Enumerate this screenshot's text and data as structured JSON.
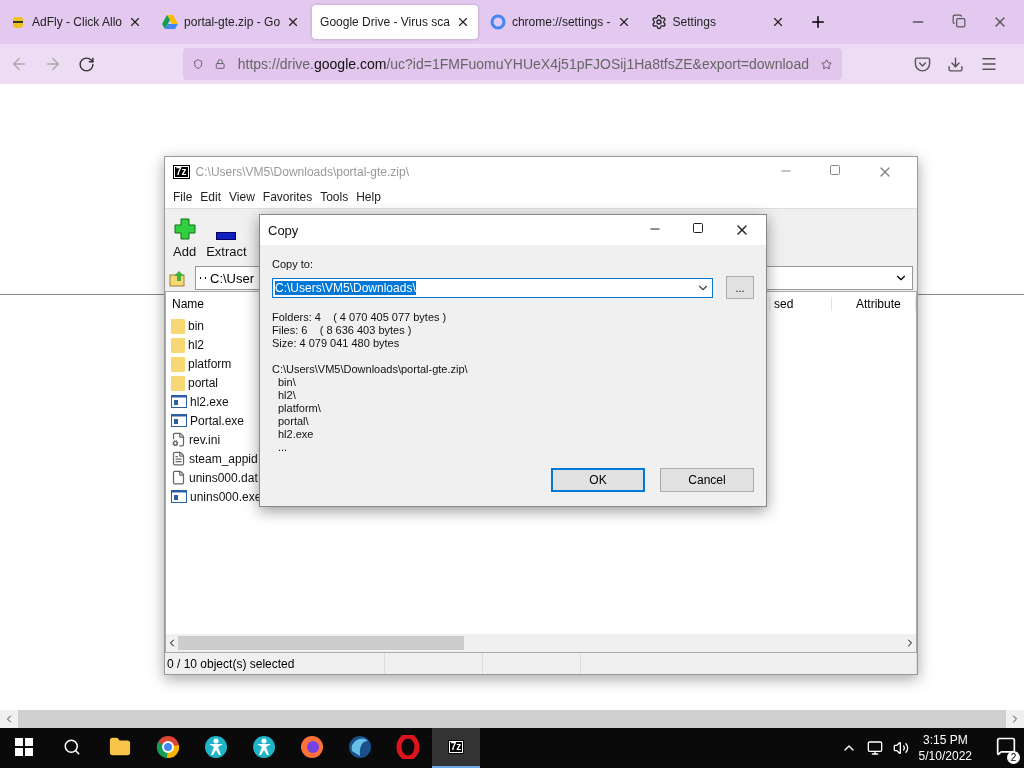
{
  "browser": {
    "tabs": [
      {
        "label": "AdFly - Click Allo",
        "selected": false,
        "kind": "bee"
      },
      {
        "label": "portal-gte.zip - Go",
        "selected": false,
        "kind": "drive"
      },
      {
        "label": "Google Drive - Virus sca",
        "selected": true,
        "kind": "none"
      },
      {
        "label": "chrome://settings -",
        "selected": false,
        "kind": "google"
      },
      {
        "label": "Settings",
        "selected": false,
        "kind": "gear"
      }
    ],
    "url": {
      "prefix": "https://drive.",
      "domain": "google.com",
      "rest": "/uc?id=1FMFuomuYHUeX4j51pFJOSij1Ha8tfsZE&export=download"
    }
  },
  "archiver": {
    "title": "C:\\Users\\VM5\\Downloads\\portal-gte.zip\\",
    "logo": "7z",
    "menu": [
      "File",
      "Edit",
      "View",
      "Favorites",
      "Tools",
      "Help"
    ],
    "toolbar": [
      {
        "label": "Add",
        "kind": "add"
      },
      {
        "label": "Extract",
        "kind": "extract"
      }
    ],
    "address": "C:\\User",
    "columns": [
      "Name",
      "sed",
      "Attribute"
    ],
    "files": [
      {
        "name": "bin",
        "kind": "folder"
      },
      {
        "name": "hl2",
        "kind": "folder"
      },
      {
        "name": "platform",
        "kind": "folder"
      },
      {
        "name": "portal",
        "kind": "folder"
      },
      {
        "name": "hl2.exe",
        "kind": "exe"
      },
      {
        "name": "Portal.exe",
        "kind": "exe"
      },
      {
        "name": "rev.ini",
        "kind": "config"
      },
      {
        "name": "steam_appid",
        "kind": "text"
      },
      {
        "name": "unins000.dat",
        "kind": "file"
      },
      {
        "name": "unins000.exe",
        "kind": "exe"
      }
    ],
    "status": "0 / 10 object(s) selected"
  },
  "dialog": {
    "title": "Copy",
    "label": "Copy to:",
    "value": "C:\\Users\\VM5\\Downloads\\",
    "browse": "...",
    "info": [
      "Folders: 4    ( 4 070 405 077 bytes )",
      "Files: 6    ( 8 636 403 bytes )",
      "Size: 4 079 041 480 bytes"
    ],
    "listing": {
      "path": "C:\\Users\\VM5\\Downloads\\portal-gte.zip\\",
      "items": [
        "bin\\",
        "hl2\\",
        "platform\\",
        "portal\\",
        "hl2.exe",
        "..."
      ]
    },
    "buttons": [
      {
        "label": "OK",
        "selected": true
      },
      {
        "label": "Cancel",
        "selected": false
      }
    ]
  },
  "taskbar": {
    "apps": [
      {
        "kind": "folder",
        "selected": false
      },
      {
        "kind": "chrome",
        "selected": false
      },
      {
        "kind": "person",
        "selected": false
      },
      {
        "kind": "person",
        "selected": false
      },
      {
        "kind": "firefox",
        "selected": false
      },
      {
        "kind": "orb",
        "selected": false
      },
      {
        "kind": "opera",
        "selected": false
      },
      {
        "kind": "sevenzip",
        "label": "7z",
        "selected": true
      }
    ],
    "time": "3:15 PM",
    "date": "5/10/2022",
    "notifications": "2"
  }
}
